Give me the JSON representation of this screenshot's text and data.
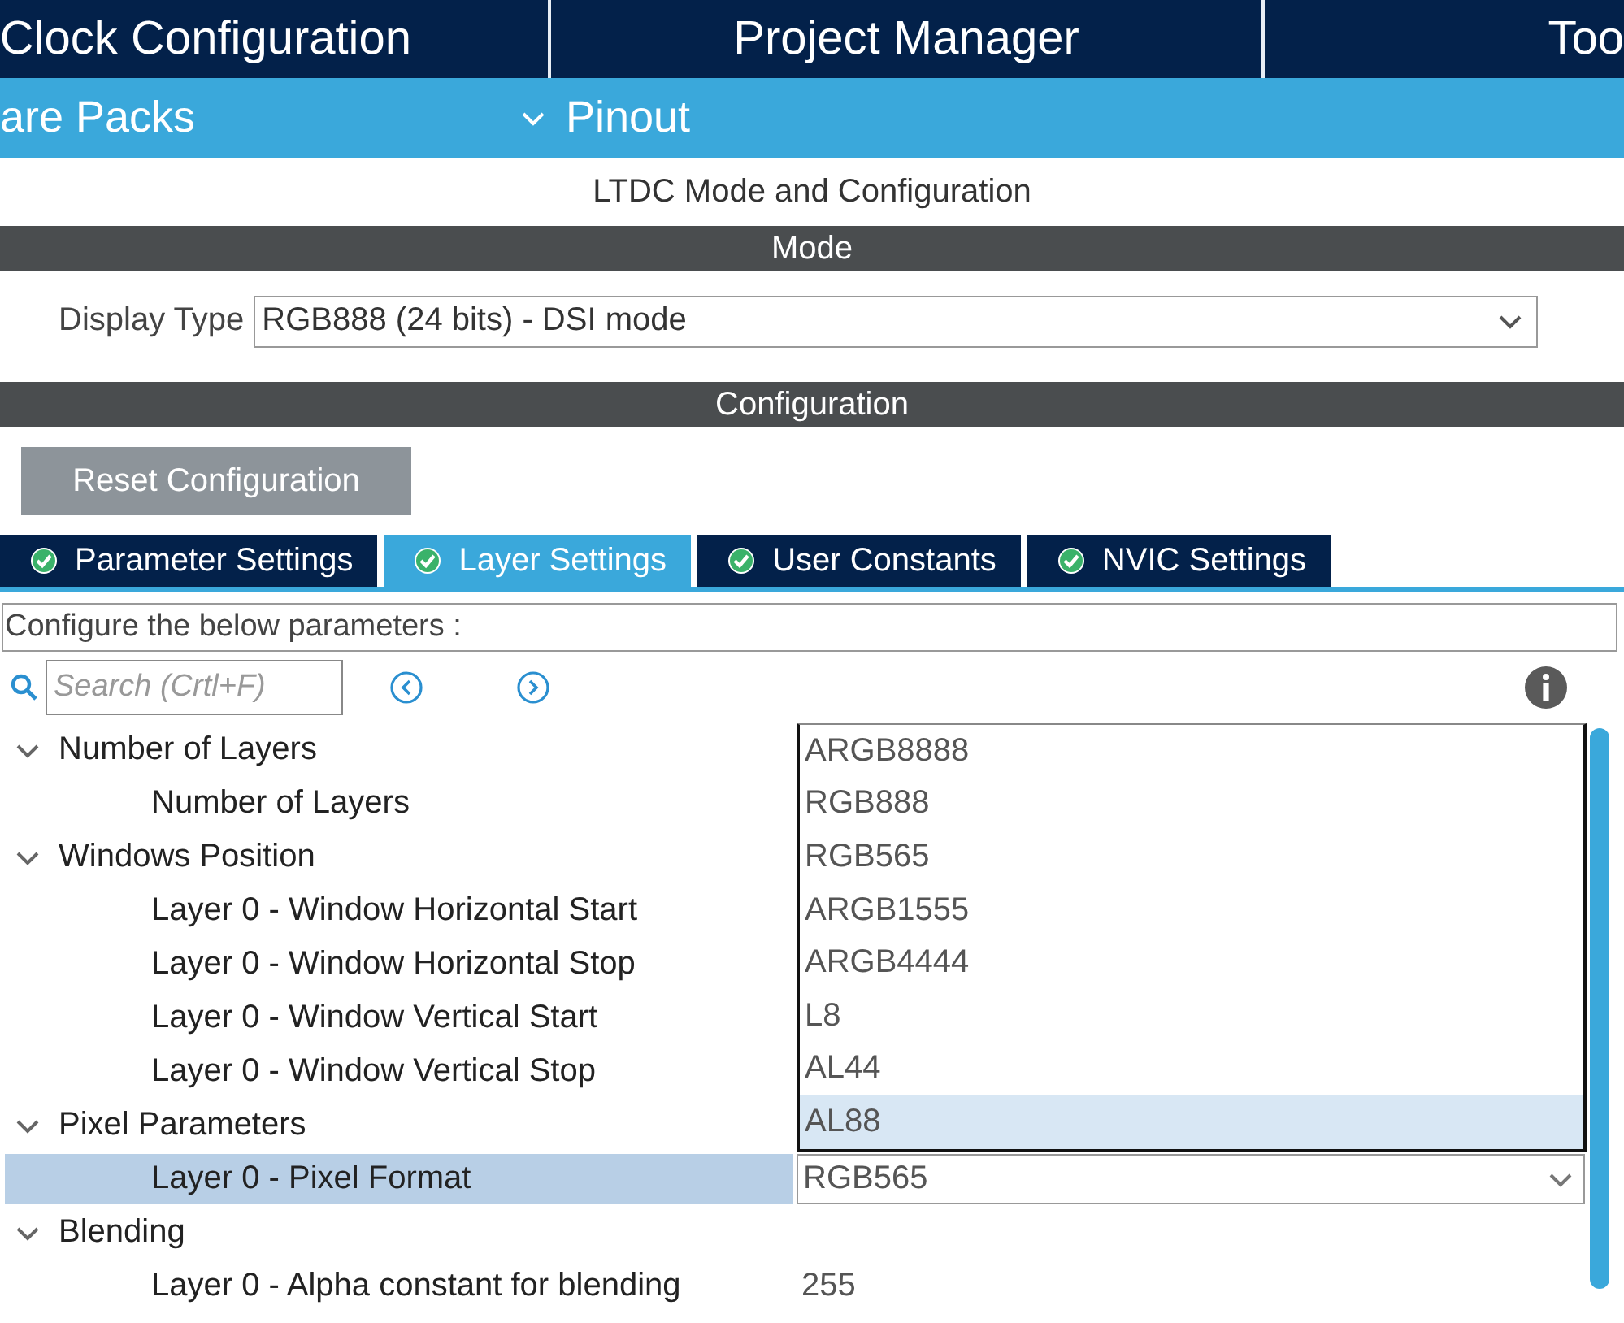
{
  "top_tabs": [
    {
      "label": "Clock Configuration"
    },
    {
      "label": "Project Manager"
    },
    {
      "label": "Too"
    }
  ],
  "sub_bar": {
    "left_label": "are Packs",
    "menu": {
      "label": "Pinout",
      "expanded": true
    }
  },
  "panel_title": "LTDC Mode and Configuration",
  "mode": {
    "header": "Mode",
    "display_type_label": "Display Type",
    "display_type_value": "RGB888 (24 bits) - DSI mode"
  },
  "configuration": {
    "header": "Configuration",
    "reset_button": "Reset Configuration"
  },
  "tabs": [
    {
      "label": "Parameter Settings",
      "selected": false
    },
    {
      "label": "Layer Settings",
      "selected": true
    },
    {
      "label": "User Constants",
      "selected": false
    },
    {
      "label": "NVIC Settings",
      "selected": false
    }
  ],
  "hint": "Configure the below parameters :",
  "search": {
    "placeholder": "Search (Crtl+F)"
  },
  "tree": [
    {
      "label": "Number of Layers",
      "expanded": true,
      "children": [
        {
          "label": "Number of Layers",
          "selected": false
        }
      ]
    },
    {
      "label": "Windows Position",
      "expanded": true,
      "children": [
        {
          "label": "Layer 0 - Window Horizontal Start",
          "selected": false
        },
        {
          "label": "Layer 0 - Window Horizontal Stop",
          "selected": false
        },
        {
          "label": "Layer 0 - Window Vertical Start",
          "selected": false
        },
        {
          "label": "Layer 0 - Window Vertical Stop",
          "selected": false
        }
      ]
    },
    {
      "label": "Pixel Parameters",
      "expanded": true,
      "children": [
        {
          "label": "Layer 0 - Pixel Format",
          "selected": true,
          "value": "RGB565",
          "kind": "select"
        }
      ]
    },
    {
      "label": "Blending",
      "expanded": true,
      "children": [
        {
          "label": "Layer 0 - Alpha constant for blending",
          "selected": false,
          "value": "255",
          "kind": "text"
        }
      ]
    }
  ],
  "dropdown": {
    "options": [
      {
        "label": "ARGB8888",
        "selected": false
      },
      {
        "label": "RGB888",
        "selected": false
      },
      {
        "label": "RGB565",
        "selected": false
      },
      {
        "label": "ARGB1555",
        "selected": false
      },
      {
        "label": "ARGB4444",
        "selected": false
      },
      {
        "label": "L8",
        "selected": false
      },
      {
        "label": "AL44",
        "selected": false
      },
      {
        "label": "AL88",
        "selected": true
      }
    ]
  }
}
